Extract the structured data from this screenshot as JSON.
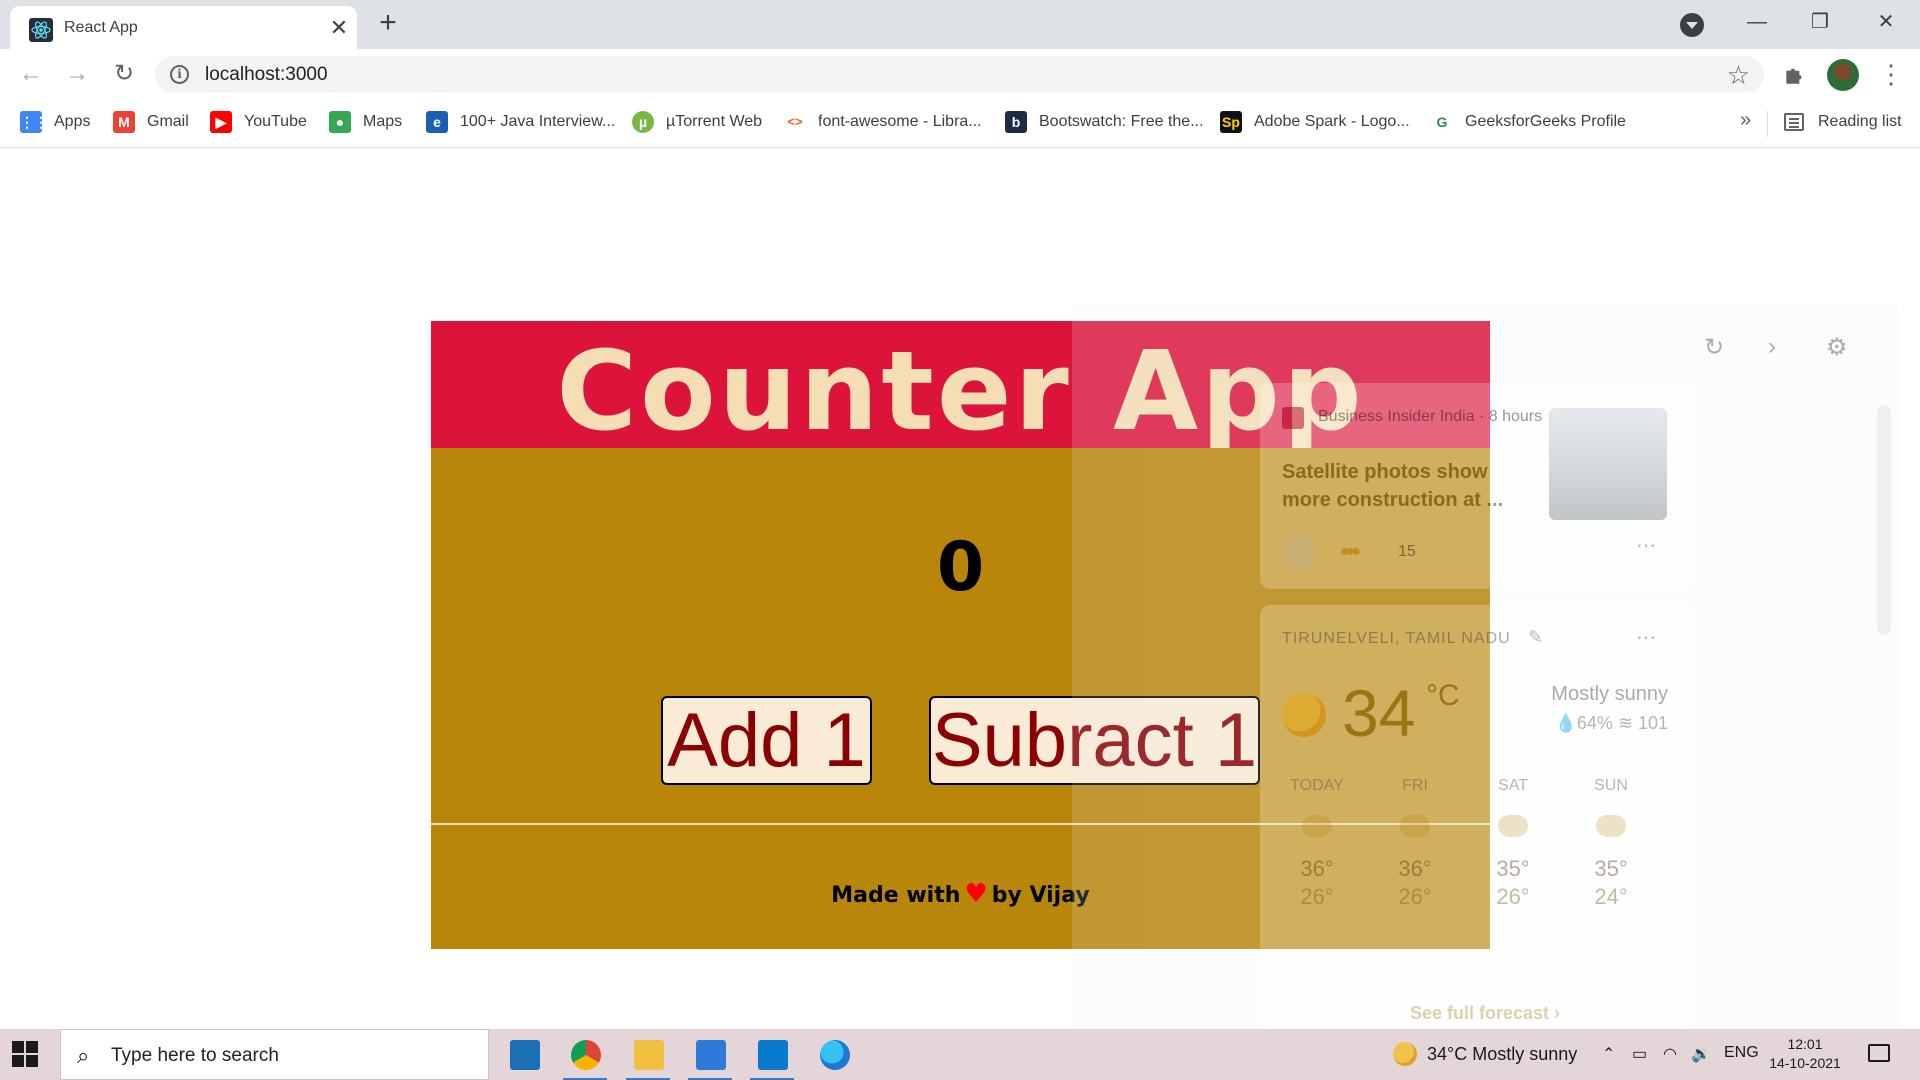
{
  "browser": {
    "tab_title": "React App",
    "tab_close": "✕",
    "new_tab": "+",
    "url": "localhost:3000",
    "back": "←",
    "forward": "→",
    "reload": "↻",
    "star": "☆",
    "menu": "⋮",
    "win_minimize": "—",
    "win_restore": "❐",
    "win_close": "✕",
    "bookmarks": [
      {
        "label": "Apps",
        "icon": "apps-grid-icon",
        "icon_glyph": "⋮⋮",
        "color": "#4285f4"
      },
      {
        "label": "Gmail",
        "icon": "gmail-icon",
        "icon_glyph": "M",
        "color": "#ea4335"
      },
      {
        "label": "YouTube",
        "icon": "youtube-icon",
        "icon_glyph": "▶",
        "color": "#ff0000"
      },
      {
        "label": "Maps",
        "icon": "maps-pin-icon",
        "icon_glyph": "●",
        "color": "#34a853"
      },
      {
        "label": "100+ Java Interview...",
        "icon": "edureka-icon",
        "icon_glyph": "e",
        "color": "#1a5fb4"
      },
      {
        "label": "µTorrent Web",
        "icon": "utorrent-icon",
        "icon_glyph": "µ",
        "color": "#77b843"
      },
      {
        "label": "font-awesome - Libra...",
        "icon": "code-brackets-icon",
        "icon_glyph": "<>",
        "color": "#f06529"
      },
      {
        "label": "Bootswatch: Free the...",
        "icon": "bootswatch-icon",
        "icon_glyph": "b",
        "color": "#1f2a44"
      },
      {
        "label": "Adobe Spark - Logo...",
        "icon": "adobe-spark-icon",
        "icon_glyph": "Sp",
        "color": "#111111"
      },
      {
        "label": "GeeksforGeeks Profile",
        "icon": "geeksforgeeks-icon",
        "icon_glyph": "G",
        "color": "#2f8d46"
      }
    ],
    "bookmarks_overflow": "»",
    "reading_list": "Reading list"
  },
  "app": {
    "title": "Counter App",
    "count": "0",
    "add_label": "Add 1",
    "subtract_label": "Subract 1",
    "footer_before": "Made with",
    "footer_heart": "♥",
    "footer_after": "by Vijay",
    "colors": {
      "header": "#dc143c",
      "title": "#f5deb3",
      "body": "#b8860b",
      "button_bg": "#faebd7",
      "button_text": "#8b0000"
    }
  },
  "widgets": {
    "news": {
      "source": "Business Insider India · 8 hours",
      "headline": "Satellite photos show more construction at ...",
      "reactions": "15"
    },
    "weather": {
      "location": "TIRUNELVELI, TAMIL NADU",
      "temp": "34",
      "unit": "°C",
      "condition": "Mostly sunny",
      "humidity": "💧64%  ≋ 101",
      "days": [
        {
          "name": "TODAY",
          "hi": "36°",
          "lo": "26°"
        },
        {
          "name": "FRI",
          "hi": "36°",
          "lo": "26°"
        },
        {
          "name": "SAT",
          "hi": "35°",
          "lo": "26°"
        },
        {
          "name": "SUN",
          "hi": "35°",
          "lo": "24°"
        }
      ],
      "forecast_link": "See full forecast ›"
    }
  },
  "taskbar": {
    "search_placeholder": "Type here to search",
    "weather": "34°C  Mostly sunny",
    "language": "ENG",
    "time": "12:01",
    "date": "14-10-2021",
    "apps": [
      {
        "name": "prime-video",
        "color": "#1b6fb5"
      },
      {
        "name": "chrome",
        "color": "#db4437"
      },
      {
        "name": "file-explorer",
        "color": "#f0c040"
      },
      {
        "name": "photos",
        "color": "#2f7ad8"
      },
      {
        "name": "vscode",
        "color": "#0a7acc"
      },
      {
        "name": "edge",
        "color": "#1c9ad6"
      }
    ]
  }
}
